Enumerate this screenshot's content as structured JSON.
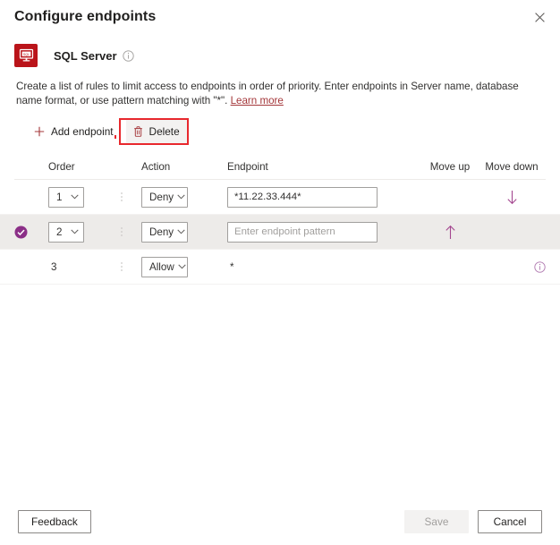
{
  "header": {
    "title": "Configure endpoints",
    "close_icon": "close-icon",
    "close_label": "Close"
  },
  "resource": {
    "icon_name": "sql-server-icon",
    "icon_text": "SQL",
    "name": "SQL Server",
    "info_icon": "info-icon"
  },
  "description": {
    "text_before_link": "Create a list of rules to limit access to endpoints in order of priority. Enter endpoints in Server name, database name format, or use pattern matching with \"*\". ",
    "link_text": "Learn more"
  },
  "commandbar": {
    "add_label": "Add endpoint",
    "add_icon": "plus-icon",
    "delete_label": "Delete",
    "delete_icon": "trash-icon"
  },
  "table": {
    "columns": {
      "order": "Order",
      "action": "Action",
      "endpoint": "Endpoint",
      "move_up": "Move up",
      "move_down": "Move down"
    },
    "rows": [
      {
        "selected": false,
        "order": "1",
        "order_editable": true,
        "action": "Deny",
        "action_editable": true,
        "endpoint_value": "*11.22.33.444*",
        "endpoint_placeholder": "Enter endpoint pattern",
        "endpoint_editable": true,
        "move_up": false,
        "move_down": true,
        "info": false
      },
      {
        "selected": true,
        "order": "2",
        "order_editable": true,
        "action": "Deny",
        "action_editable": true,
        "endpoint_value": "",
        "endpoint_placeholder": "Enter endpoint pattern",
        "endpoint_editable": true,
        "move_up": true,
        "move_down": false,
        "info": false
      },
      {
        "selected": false,
        "order": "3",
        "order_editable": false,
        "action": "Allow",
        "action_editable": true,
        "endpoint_value": "*",
        "endpoint_placeholder": "",
        "endpoint_editable": false,
        "move_up": false,
        "move_down": false,
        "info": true
      }
    ]
  },
  "footer": {
    "feedback_label": "Feedback",
    "save_label": "Save",
    "save_disabled": true,
    "cancel_label": "Cancel"
  },
  "colors": {
    "brand_red": "#ba141a",
    "link": "#a4373a",
    "annotation": "#e8282d",
    "accent_purple": "#a4468f",
    "selected_row": "#edebe9"
  }
}
